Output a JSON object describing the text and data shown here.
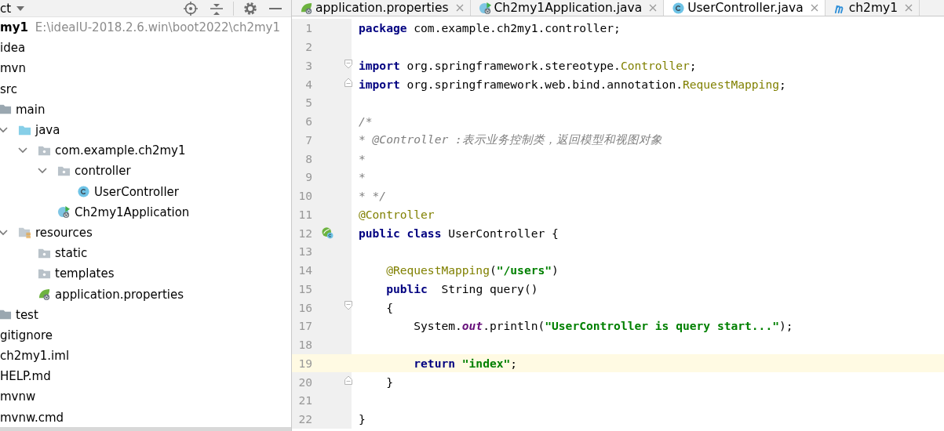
{
  "project_panel": {
    "toolbar": {
      "title": "ct"
    },
    "tree": {
      "label": "my1",
      "path": "E:\\idealU-2018.2.6.win\\boot2022\\ch2my1",
      "children": [
        {
          "label": "idea"
        },
        {
          "label": "mvn"
        },
        {
          "label": "src",
          "children": [
            {
              "label": "main",
              "kind": "folder",
              "children": [
                {
                  "label": "java",
                  "kind": "source-folder",
                  "expanded": true,
                  "children": [
                    {
                      "label": "com.example.ch2my1",
                      "kind": "marked-folder",
                      "expanded": true,
                      "children": [
                        {
                          "label": "controller",
                          "kind": "marked-folder",
                          "expanded": true,
                          "children": [
                            {
                              "label": "UserController",
                              "kind": "class"
                            }
                          ]
                        },
                        {
                          "label": "Ch2my1Application",
                          "kind": "spring-app"
                        }
                      ]
                    }
                  ]
                },
                {
                  "label": "resources",
                  "kind": "resources-folder",
                  "expanded": true,
                  "children": [
                    {
                      "label": "static",
                      "kind": "marked-folder"
                    },
                    {
                      "label": "templates",
                      "kind": "marked-folder"
                    },
                    {
                      "label": "application.properties",
                      "kind": "spring-properties"
                    }
                  ]
                }
              ]
            },
            {
              "label": "test",
              "kind": "folder"
            }
          ]
        },
        {
          "label": "gitignore"
        },
        {
          "label": "ch2my1.iml"
        },
        {
          "label": "HELP.md"
        },
        {
          "label": "mvnw"
        },
        {
          "label": "mvnw.cmd"
        }
      ]
    }
  },
  "editor": {
    "tabs": [
      {
        "label": "application.properties",
        "kind": "spring-properties",
        "selected": false
      },
      {
        "label": "Ch2my1Application.java",
        "kind": "spring-app",
        "selected": false
      },
      {
        "label": "UserController.java",
        "kind": "class",
        "selected": true
      },
      {
        "label": "ch2my1",
        "kind": "maven",
        "selected": false
      }
    ],
    "lines": [
      {
        "number": "1",
        "current": false,
        "tokens": [
          {
            "kind": "keyword",
            "text": "package"
          },
          {
            "kind": "plain",
            "text": " com.example.ch2my1.controller;"
          }
        ]
      },
      {
        "number": "2",
        "current": false
      },
      {
        "number": "3",
        "current": false,
        "fold_start": true,
        "tokens": [
          {
            "kind": "keyword",
            "text": "import"
          },
          {
            "kind": "plain",
            "text": " org.springframework.stereotype."
          },
          {
            "kind": "reference",
            "text": "Controller"
          },
          {
            "kind": "plain",
            "text": ";"
          }
        ]
      },
      {
        "number": "4",
        "current": false,
        "fold_end": true,
        "tokens": [
          {
            "kind": "keyword",
            "text": "import"
          },
          {
            "kind": "plain",
            "text": " org.springframework.web.bind.annotation."
          },
          {
            "kind": "reference",
            "text": "RequestMapping"
          },
          {
            "kind": "plain",
            "text": ";"
          }
        ]
      },
      {
        "number": "5",
        "current": false
      },
      {
        "number": "6",
        "current": false,
        "tokens": [
          {
            "kind": "comment",
            "text": "/*"
          }
        ]
      },
      {
        "number": "7",
        "current": false,
        "tokens": [
          {
            "kind": "comment",
            "text": "* @Controller :表示业务控制类，返回模型和视图对象"
          }
        ]
      },
      {
        "number": "8",
        "current": false,
        "tokens": [
          {
            "kind": "comment",
            "text": "*"
          }
        ]
      },
      {
        "number": "9",
        "current": false,
        "tokens": [
          {
            "kind": "comment",
            "text": "*"
          }
        ]
      },
      {
        "number": "10",
        "current": false,
        "tokens": [
          {
            "kind": "comment",
            "text": "* */"
          }
        ]
      },
      {
        "number": "11",
        "current": false,
        "tokens": [
          {
            "kind": "annotation",
            "text": "@Controller"
          }
        ]
      },
      {
        "number": "12",
        "current": false,
        "bean_marker": true,
        "tokens": [
          {
            "kind": "keyword",
            "text": "public"
          },
          {
            "kind": "keyword",
            "text": " class"
          },
          {
            "kind": "plain",
            "text": " UserController {"
          }
        ]
      },
      {
        "number": "13",
        "current": false
      },
      {
        "number": "14",
        "current": false,
        "tokens": [
          {
            "kind": "annotation",
            "text": "    @RequestMapping"
          },
          {
            "kind": "plain",
            "text": "("
          },
          {
            "kind": "string",
            "text": "\"/users\""
          },
          {
            "kind": "plain",
            "text": ")"
          }
        ]
      },
      {
        "number": "15",
        "current": false,
        "tokens": [
          {
            "kind": "keyword",
            "text": "    public"
          },
          {
            "kind": "plain",
            "text": "  String query()"
          }
        ]
      },
      {
        "number": "16",
        "current": false,
        "fold_start": true,
        "tokens": [
          {
            "kind": "plain",
            "text": "    {"
          }
        ]
      },
      {
        "number": "17",
        "current": false,
        "tokens": [
          {
            "kind": "plain",
            "text": "        System."
          },
          {
            "kind": "field",
            "text": "out"
          },
          {
            "kind": "plain",
            "text": ".println("
          },
          {
            "kind": "string",
            "text": "\"UserController is query start...\""
          },
          {
            "kind": "plain",
            "text": ");"
          }
        ]
      },
      {
        "number": "18",
        "current": false
      },
      {
        "number": "19",
        "current": true,
        "tokens": [
          {
            "kind": "keyword",
            "text": "        return"
          },
          {
            "kind": "string",
            "text": " \"index\""
          },
          {
            "kind": "plain",
            "text": ";"
          }
        ]
      },
      {
        "number": "20",
        "current": false,
        "fold_end": true,
        "tokens": [
          {
            "kind": "plain",
            "text": "    }"
          }
        ]
      },
      {
        "number": "21",
        "current": false
      },
      {
        "number": "22",
        "current": false,
        "tokens": [
          {
            "kind": "plain",
            "text": "}"
          }
        ]
      }
    ]
  }
}
